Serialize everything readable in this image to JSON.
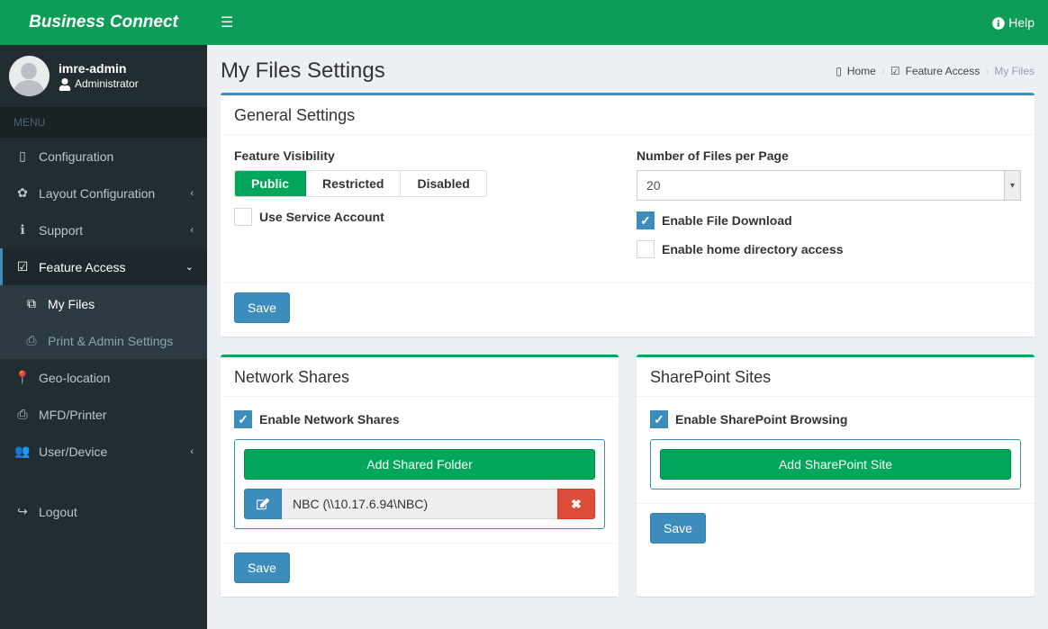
{
  "brand": "Business Connect",
  "user": {
    "name": "imre-admin",
    "role": "Administrator"
  },
  "menu_header": "MENU",
  "nav": {
    "configuration": "Configuration",
    "layout": "Layout Configuration",
    "support": "Support",
    "feature_access": "Feature Access",
    "my_files": "My Files",
    "print_admin": "Print & Admin Settings",
    "geo": "Geo-location",
    "mfd": "MFD/Printer",
    "user_device": "User/Device",
    "logout": "Logout"
  },
  "topbar": {
    "help": "Help"
  },
  "page": {
    "title": "My Files Settings"
  },
  "breadcrumb": {
    "home": "Home",
    "feature_access": "Feature Access",
    "my_files": "My Files"
  },
  "general": {
    "title": "General Settings",
    "visibility_label": "Feature Visibility",
    "opts": {
      "public": "Public",
      "restricted": "Restricted",
      "disabled": "Disabled"
    },
    "use_service": "Use Service Account",
    "files_per_page_label": "Number of Files per Page",
    "files_per_page_value": "20",
    "enable_download": "Enable File Download",
    "enable_home": "Enable home directory access",
    "save": "Save"
  },
  "shares": {
    "title": "Network Shares",
    "enable": "Enable Network Shares",
    "add": "Add Shared Folder",
    "item": "NBC (\\\\10.17.6.94\\NBC)",
    "save": "Save"
  },
  "sharepoint": {
    "title": "SharePoint Sites",
    "enable": "Enable SharePoint Browsing",
    "add": "Add SharePoint Site",
    "save": "Save"
  }
}
